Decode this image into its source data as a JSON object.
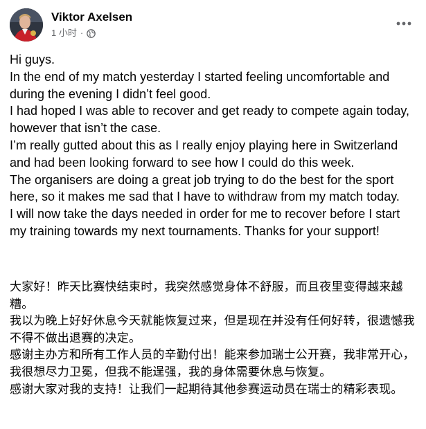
{
  "post": {
    "author_name": "Viktor Axelsen",
    "timestamp": "1 小时",
    "separator": "·",
    "privacy_icon": "globe-icon",
    "more_icon": "more-options-icon",
    "avatar_icon": "profile-photo"
  },
  "english_paragraphs": [
    "Hi guys.",
    "In the end of my match yesterday I started feeling uncomfortable and during the evening I didn’t feel good.",
    "I had hoped I was able to recover and get ready to compete again today, however that isn’t the case.",
    "I’m really gutted about this as I really enjoy playing here in Switzerland and had been looking forward to see how I could do this week.",
    "The organisers are doing a great job trying to do the best for the sport here, so it makes me sad that I have to withdraw from my match today.",
    "I will now take the days needed in order for me to recover before I start my training towards my next tournaments. Thanks for your support!"
  ],
  "chinese_paragraphs": [
    "大家好！昨天比赛快结束时，我突然感觉身体不舒服，而且夜里变得越来越糟。",
    "我以为晚上好好休息今天就能恢复过来，但是现在并没有任何好转，很遗憾我不得不做出退赛的决定。",
    "感谢主办方和所有工作人员的辛勤付出！能来参加瑞士公开赛，我非常开心，我很想尽力卫冕，但我不能逞强，我的身体需要休息与恢复。",
    "感谢大家对我的支持！让我们一起期待其他参赛运动员在瑞士的精彩表现。"
  ]
}
